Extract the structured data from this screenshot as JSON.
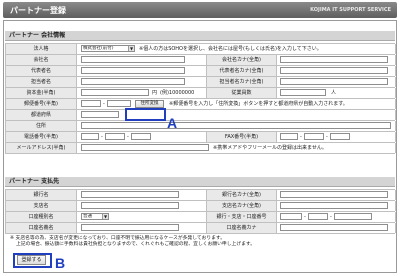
{
  "header": {
    "title": "パートナー登録",
    "brand": "KOJIMA IT SUPPORT SERVICE"
  },
  "company_section": {
    "heading": "パートナー 会社情報",
    "corp_type": {
      "label": "法人格",
      "value": "株式会社(前付)",
      "note": "※個人の方はSOHOを選択し、会社名には屋号(もしくは氏名)を入力して下さい。"
    },
    "company_name": {
      "label": "会社名"
    },
    "company_name_kana": {
      "label": "会社名カナ(全角)"
    },
    "rep_name": {
      "label": "代表者名"
    },
    "rep_name_kana": {
      "label": "代表者名カナ(全角)"
    },
    "contact_name": {
      "label": "担当者名"
    },
    "contact_name_kana": {
      "label": "担当者名カナ(全角)"
    },
    "capital": {
      "label": "資本金(半角)",
      "unit": "円",
      "example": "(例)10000000"
    },
    "employees": {
      "label": "従業員数",
      "unit": "人"
    },
    "postal": {
      "label": "郵便番号(半角)",
      "lookup_button": "住所変換",
      "note": "※郵便番号を入力し「住所変換」ボタンを押すと都道府県が自動入力されます。"
    },
    "prefecture": {
      "label": "都道府県"
    },
    "address": {
      "label": "住所"
    },
    "phone": {
      "label": "電話番号(半角)"
    },
    "fax": {
      "label": "FAX番号(半角)"
    },
    "email": {
      "label": "メールアドレス(半角)",
      "note": "※携帯メアドやフリーメールの登録は出来ません。"
    }
  },
  "payment_section": {
    "heading": "パートナー 支払先",
    "bank_name": {
      "label": "銀行名"
    },
    "bank_name_kana": {
      "label": "銀行名カナ(全角)"
    },
    "branch_name": {
      "label": "支店名"
    },
    "branch_name_kana": {
      "label": "支店名カナ(全角)"
    },
    "account_type": {
      "label": "口座種別名",
      "value": "普通"
    },
    "codes": {
      "label": "銀行・支店・口座番号"
    },
    "holder_name": {
      "label": "口座名義名"
    },
    "holder_name_kana": {
      "label": "口座名義カナ"
    }
  },
  "footer_note": {
    "line1": "※ 支店名等の為、支店名が変更になっており、口座不明で振込用になるケースが多発しております。",
    "line2": "上記の場合、振込額に手数料は貴社負担となりますので、くれぐれもご確認の程、宜しくお願い申し上げます。"
  },
  "submit_button": "登録する",
  "callouts": {
    "a": "A",
    "b": "B"
  },
  "colors": {
    "callout": "#1f3fbf",
    "header": "#6a6a6a",
    "label_bg": "#e9e9e9"
  }
}
